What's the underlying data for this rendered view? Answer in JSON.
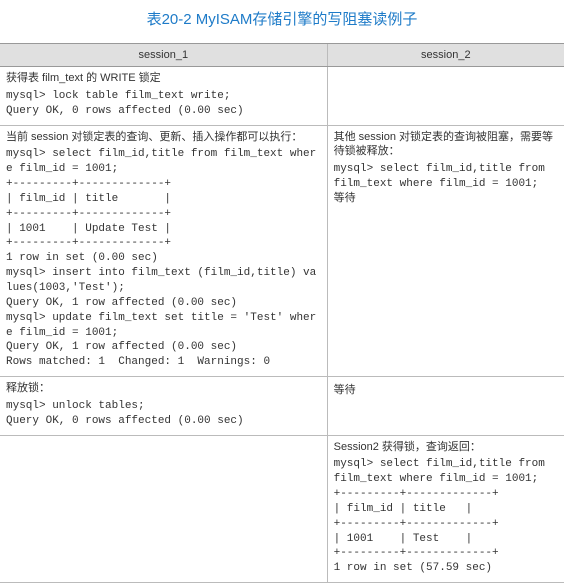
{
  "title": "表20-2 MyISAM存储引擎的写阻塞读例子",
  "headers": {
    "s1": "session_1",
    "s2": "session_2"
  },
  "rows": [
    {
      "s1_note": "获得表 film_text 的 WRITE 锁定",
      "s1_code": "mysql> lock table film_text write;\nQuery OK, 0 rows affected (0.00 sec)",
      "s2_note": "",
      "s2_code": ""
    },
    {
      "s1_note": "当前 session 对锁定表的查询、更新、插入操作都可以执行：",
      "s1_code": "mysql> select film_id,title from film_text where film_id = 1001;\n+---------+-------------+\n| film_id | title       |\n+---------+-------------+\n| 1001    | Update Test |\n+---------+-------------+\n1 row in set (0.00 sec)\nmysql> insert into film_text (film_id,title) values(1003,'Test');\nQuery OK, 1 row affected (0.00 sec)\nmysql> update film_text set title = 'Test' where film_id = 1001;\nQuery OK, 1 row affected (0.00 sec)\nRows matched: 1  Changed: 1  Warnings: 0",
      "s2_note": "其他 session 对锁定表的查询被阻塞，需要等待锁被释放：",
      "s2_code": "mysql> select film_id,title from film_text where film_id = 1001;\n等待"
    },
    {
      "s1_note": "释放锁：",
      "s1_code": "mysql> unlock tables;\nQuery OK, 0 rows affected (0.00 sec)",
      "s2_note": "",
      "s2_code": "等待"
    },
    {
      "s1_note": "",
      "s1_code": "",
      "s2_note": "Session2 获得锁，查询返回：",
      "s2_code": "mysql> select film_id,title from film_text where film_id = 1001;\n+---------+-------------+\n| film_id | title   |\n+---------+-------------+\n| 1001    | Test    |\n+---------+-------------+\n1 row in set (57.59 sec)"
    }
  ],
  "chart_data": {
    "type": "table",
    "title": "表20-2 MyISAM存储引擎的写阻塞读例子",
    "columns": [
      "session_1",
      "session_2"
    ],
    "rows": [
      [
        "获得表 film_text 的 WRITE 锁定\nmysql> lock table film_text write;\nQuery OK, 0 rows affected (0.00 sec)",
        ""
      ],
      [
        "当前 session 对锁定表的查询、更新、插入操作都可以执行：\nmysql> select film_id,title from film_text where film_id = 1001;\n| film_id | title |\n| 1001 | Update Test |\n1 row in set (0.00 sec)\nmysql> insert into film_text (film_id,title) values(1003,'Test');\nQuery OK, 1 row affected (0.00 sec)\nmysql> update film_text set title = 'Test' where film_id = 1001;\nQuery OK, 1 row affected (0.00 sec)\nRows matched: 1  Changed: 1  Warnings: 0",
        "其他 session 对锁定表的查询被阻塞，需要等待锁被释放：\nmysql> select film_id,title from film_text where film_id = 1001;\n等待"
      ],
      [
        "释放锁：\nmysql> unlock tables;\nQuery OK, 0 rows affected (0.00 sec)",
        "等待"
      ],
      [
        "",
        "Session2 获得锁，查询返回：\nmysql> select film_id,title from film_text where film_id = 1001;\n| film_id | title |\n| 1001 | Test |\n1 row in set (57.59 sec)"
      ]
    ]
  }
}
